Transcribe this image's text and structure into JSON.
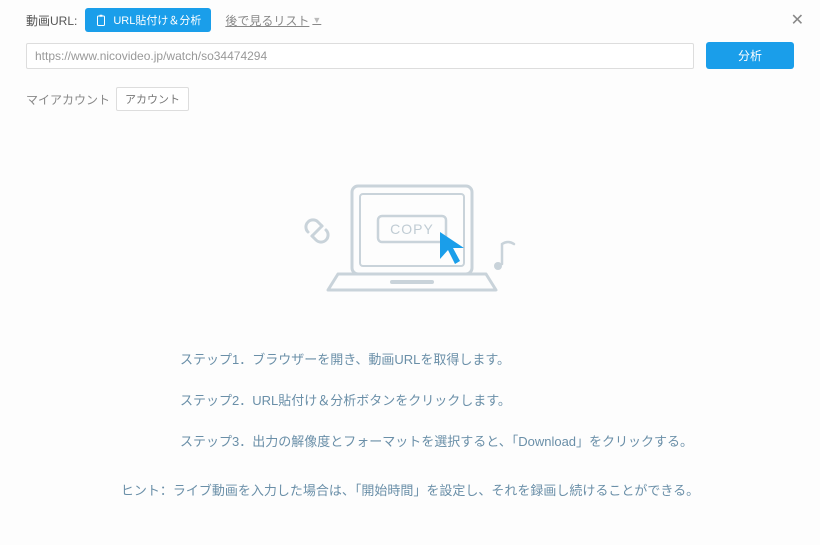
{
  "topbar": {
    "url_label": "動画URL:",
    "paste_analyze_label": "URL貼付け＆分析",
    "watch_later_label": "後で見るリスト"
  },
  "url_row": {
    "url_value": "https://www.nicovideo.jp/watch/so34474294",
    "analyze_label": "分析"
  },
  "account": {
    "my_account_label": "マイアカウント",
    "account_button_label": "アカウント"
  },
  "illustration": {
    "copy_label": "COPY"
  },
  "steps": [
    "ステップ1．ブラウザーを開き、動画URLを取得します。",
    "ステップ2．URL貼付け＆分析ボタンをクリックします。",
    "ステップ3．出力の解像度とフォーマットを選択すると、「Download」をクリックする。"
  ],
  "hint": "ヒント：ライブ動画を入力した場合は、「開始時間」を設定し、それを録画し続けることができる。"
}
